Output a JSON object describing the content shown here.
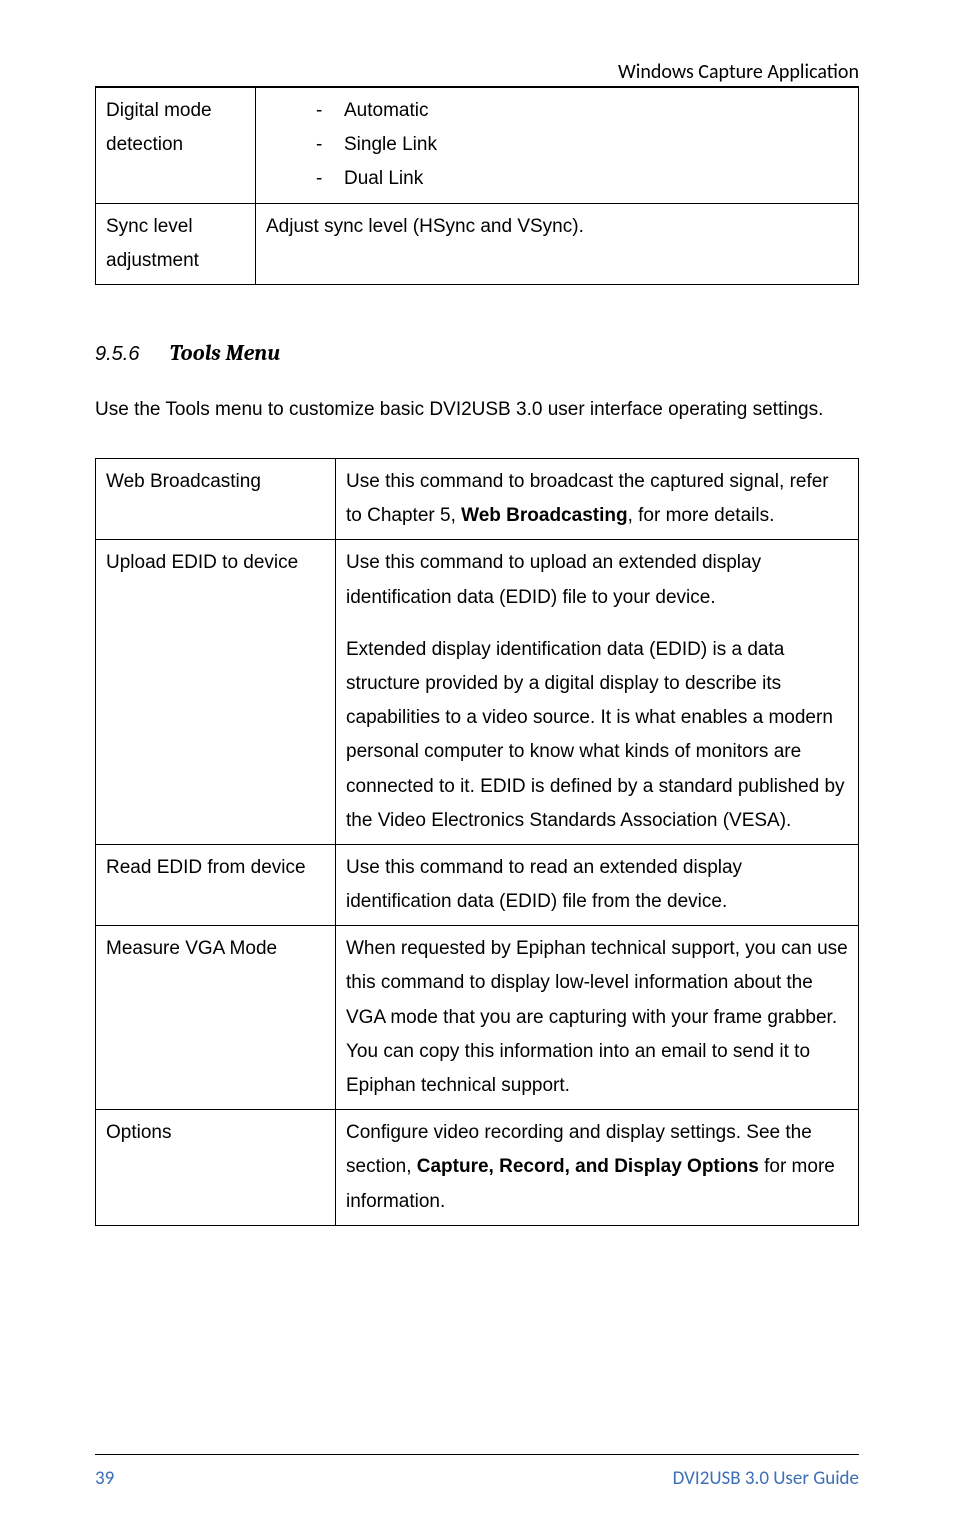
{
  "header": {
    "title": "Windows Capture Application"
  },
  "table1": {
    "rows": [
      {
        "label": "Digital mode detection",
        "items": [
          "Automatic",
          "Single Link",
          "Dual Link"
        ]
      },
      {
        "label": "Sync level adjustment",
        "text": "Adjust sync level (HSync and VSync)."
      }
    ]
  },
  "section": {
    "number": "9.5.6",
    "title": "Tools Menu"
  },
  "intro": "Use the Tools menu to customize basic DVI2USB 3.0 user interface operating settings.",
  "table2": {
    "rows": [
      {
        "label": "Web Broadcasting",
        "parts": [
          {
            "text": "Use this command to broadcast the captured signal, refer to Chapter 5, "
          },
          {
            "text": "Web Broadcasting",
            "bold": true
          },
          {
            "text": ", for more details."
          }
        ]
      },
      {
        "label": "Upload EDID to device",
        "paragraphs": [
          "Use this command to upload an extended display identification data (EDID) file to your device.",
          "Extended display identification data (EDID) is a data structure provided by a digital display to describe its capabilities to a video source. It is what enables a modern personal computer to know what kinds of monitors are connected to it. EDID is defined by a standard published by the Video Electronics Standards Association (VESA)."
        ]
      },
      {
        "label": "Read EDID from device",
        "parts": [
          {
            "text": "Use this command to read an extended display identification data (EDID) file from the device."
          }
        ]
      },
      {
        "label": "Measure VGA Mode",
        "parts": [
          {
            "text": "When requested by Epiphan technical support, you can use this command to display low-level information about the VGA mode that you are capturing with your frame grabber. You can copy this information into an email to send it to Epiphan technical support."
          }
        ]
      },
      {
        "label": "Options",
        "parts": [
          {
            "text": "Configure video recording and display settings.  See the section, "
          },
          {
            "text": "Capture, Record, and Display Options",
            "bold": true
          },
          {
            "text": " for more information."
          }
        ]
      }
    ]
  },
  "footer": {
    "page": "39",
    "guide": "DVI2USB 3.0  User Guide"
  }
}
